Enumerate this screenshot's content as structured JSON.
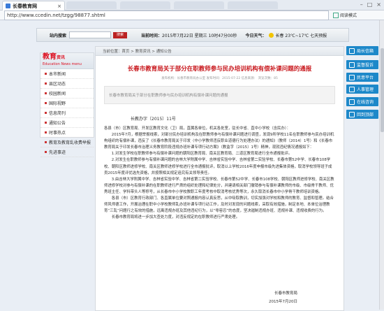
{
  "browser": {
    "tab_title": "长春教育网",
    "url": "http://www.ccedin.net/tzgg/98877.shtml",
    "reader_label": "阅读模式"
  },
  "header": {
    "search_label": "站内搜索",
    "search_button": "搜索",
    "time_label": "当前时间：",
    "time_value": "2015年7月22日 星期三 10时47分00秒",
    "weather_label": "今日天气：",
    "weather_value": "长春  23℃~17℃  七天预报"
  },
  "leftnav": {
    "title": "教育",
    "title_suffix": "资讯",
    "subtitle": "Education News menu",
    "items": [
      "本市新闻",
      "县区动态",
      "校园新闻",
      "国际视野",
      "信息简刊",
      "通知公告",
      "时事热点",
      "教育及教育乱收费举报",
      "先进事迹"
    ]
  },
  "breadcrumb": "当前位置：首页 > 教育资讯 > 通知公告",
  "article": {
    "title": "长春市教育局关于部分在职教师参与民办培训机构有偿补课问题的通报",
    "meta": "发布机构：长春市教育局办公室   发布时间：2015-07-22   信息来源：   浏览次数：85",
    "summary": "长春市教育局关于部分在职教师参与民办培训机构有偿补课问题的通报",
    "doc_no": "长教办字〔2015〕11号",
    "paragraphs": [
      "各县（市）区教育局、开发区教育文化（卫）局，直属各单位，机关各处室，驻长中省、直中小学校（含民办）：",
      "2015年7月，根据举报线索，对部分民办培训机构及在职教师参与有偿补课问题进行调查，发现9所学校11名在职教师参与民办培训机构组织的有偿补课，违反了《长春市教育局关于印发〈中小学教师违反职业道德行为处理办法〉的通知》（教师〔2014〕1号）和《长春市教育局关于印发长春市治理义务教育阶段违规办班补课专项行动方案》（教监字〔2015〕1号）精神，现就违纪情况通报如下：",
      "1.对发生学校在职教师参与有偿补课问题的朝阳区教育局、南关区教育局、二道区教育局进行全市通报批评。",
      "2.对发生在职教师参与有偿补课问题的吉林大学附属中学、吉林省实验中学、吉林省第二实验学校、长春市第52中学、长春市108学校、朝阳区教师进修学校、南关区教师进修学校进行全市通报批评，取消以上学校2016年度申报市级先进集体资格，取消学校领导班子成员2015年度评优选先资格，并按照相关规定追究有关领导责任。",
      "3.由吉林大学附属中学、吉林省实验中学、吉林省第二实验学校、长春市第52中学、长春市108学校、朝阳区教师进修学校、南关区教师进修学校对参与有偿补课的在职教师进行严肃的组织处理和纪律处分，并建请相关部门撤销参与有偿补课教师的市级、市级骨干教师、优秀班主任、学科带头人等称号，从长春市中小学校教职工年度考核中取消考核优秀等次，永久取消长春市中小学骨干教师培训资格。",
      "各县（市）区教育行政部门、各直属单位要对照通报内容认真反思，从中吸取教训，切实加强对学校和教师的教育、监督和管理。结合师风师德工作，开展治理在职中小学校教师乱办班补课专项行动工作，及时对发现的问题线索，采取有效措施，制定本地、本单位治理教育“三乱”问题行之有效的措施，远离违规办班及其他违纪行为，以“零容忍”的态度，坚决遏制违规办班、违规补课、违规收费的行为。",
      "长春市教育局将进一步加大查处力度，对违反规定的在职教师进行严肃处理。"
    ],
    "sign_org": "长春市教育局",
    "sign_date": "2015年7月20日"
  },
  "rightbar": [
    "局长信箱",
    "监督投诉",
    "民意平台",
    "人事管理",
    "在线咨询",
    "回到顶部"
  ]
}
